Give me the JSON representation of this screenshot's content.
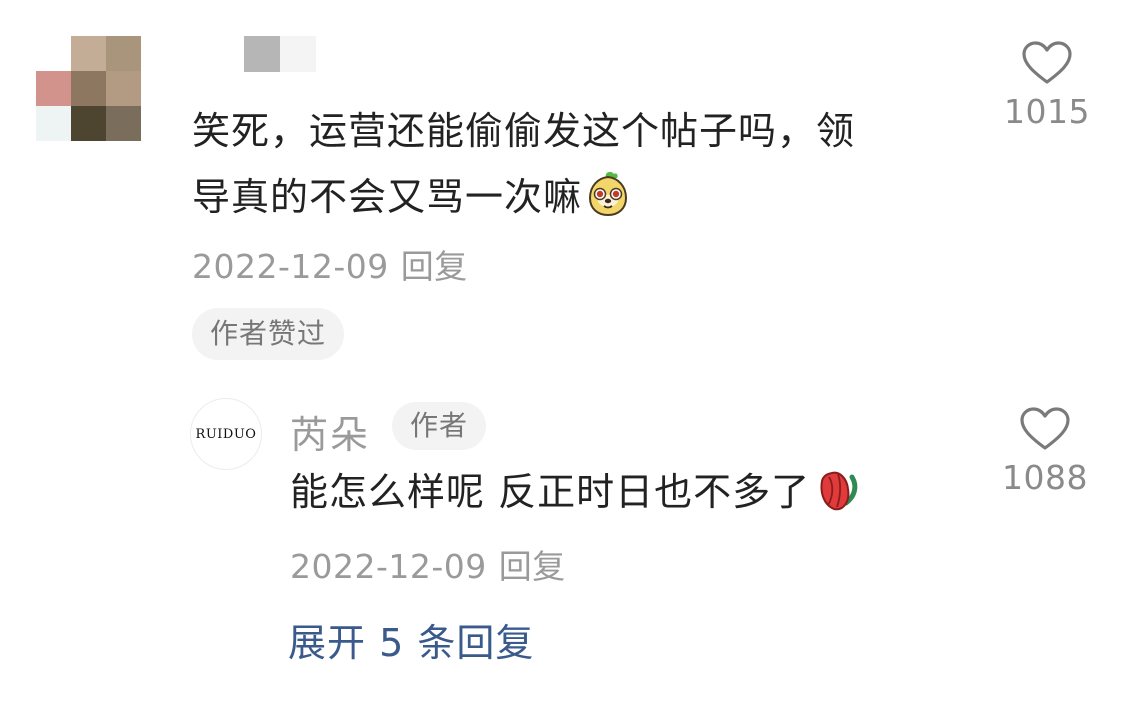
{
  "comment": {
    "text_line1": "笑死，运营还能偷偷发这个帖子吗，领",
    "text_line2": "导真的不会又骂一次嘛",
    "date": "2022-12-09",
    "reply_label": "回复",
    "author_liked_badge": "作者赞过",
    "like_count": "1015",
    "emoji_icon": "mascot-emoji-icon"
  },
  "reply": {
    "avatar_text": "RUIDUO",
    "username": "芮朵",
    "author_tag": "作者",
    "text": "能怎么样呢 反正时日也不多了",
    "date": "2022-12-09",
    "reply_label": "回复",
    "like_count": "1088",
    "emoji_icon": "rose-emoji-icon"
  },
  "expand_replies": "展开 5 条回复",
  "colors": {
    "link": "#3a5a8c",
    "meta_text": "#9a9a9a",
    "badge_bg": "#f3f3f3"
  }
}
